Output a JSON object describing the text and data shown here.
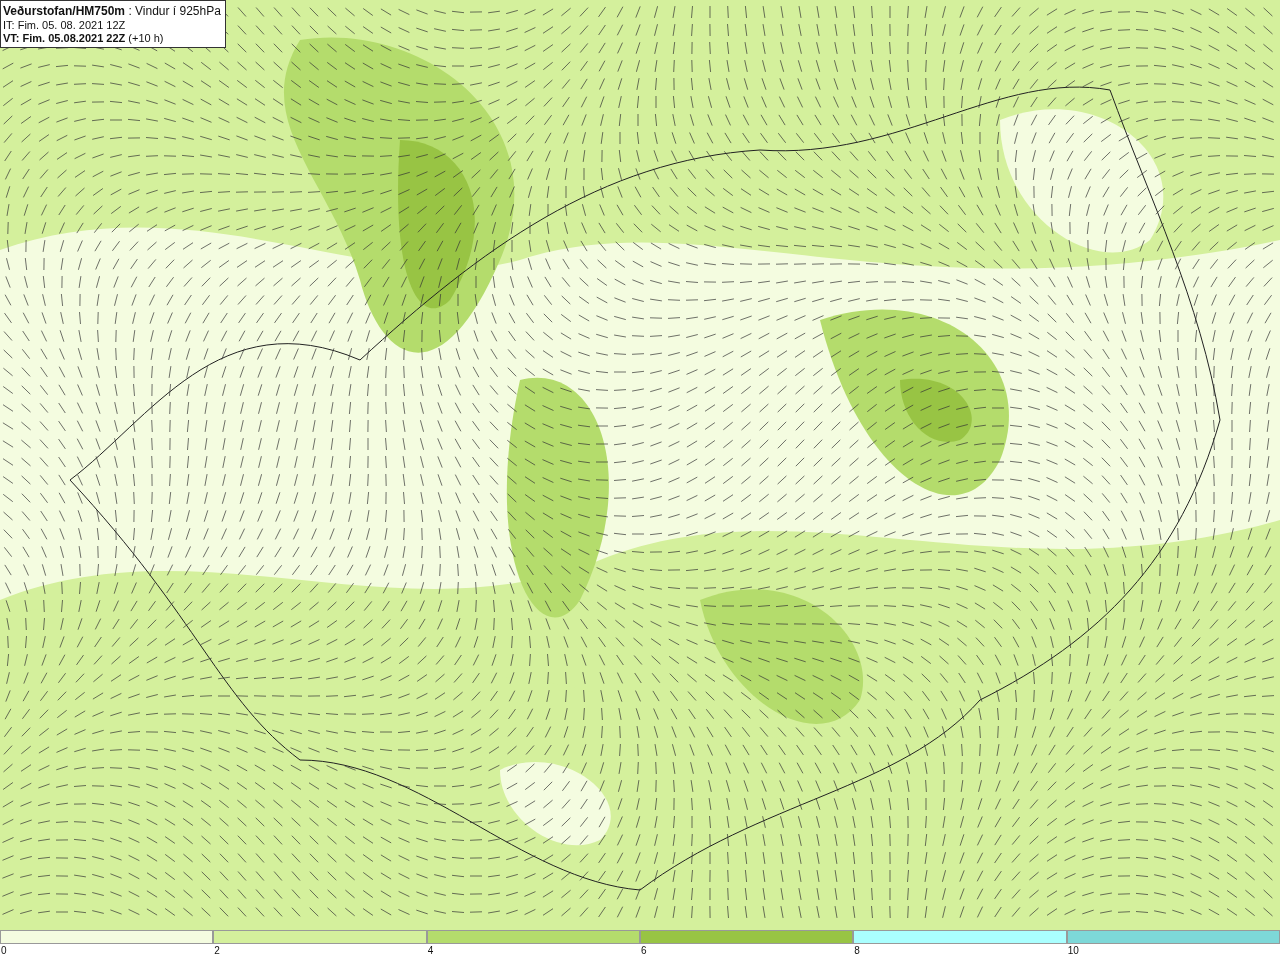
{
  "header": {
    "lines": [
      "**Veðurstofan/HM750m** : Vindur í 925hPa",
      "IT: Fim. 05. 08. 2021 12Z",
      "**VT: Fim. 05.08.2021 22Z** (+10 h)"
    ]
  },
  "legend": [
    {
      "label": "0",
      "color": "#f4fce0"
    },
    {
      "label": "2",
      "color": "#d4f09c"
    },
    {
      "label": "4",
      "color": "#b4dc6c"
    },
    {
      "label": "6",
      "color": "#98c444"
    },
    {
      "label": "8",
      "color": "#aaffff"
    },
    {
      "label": "10",
      "color": "#7dd8d8"
    }
  ]
}
